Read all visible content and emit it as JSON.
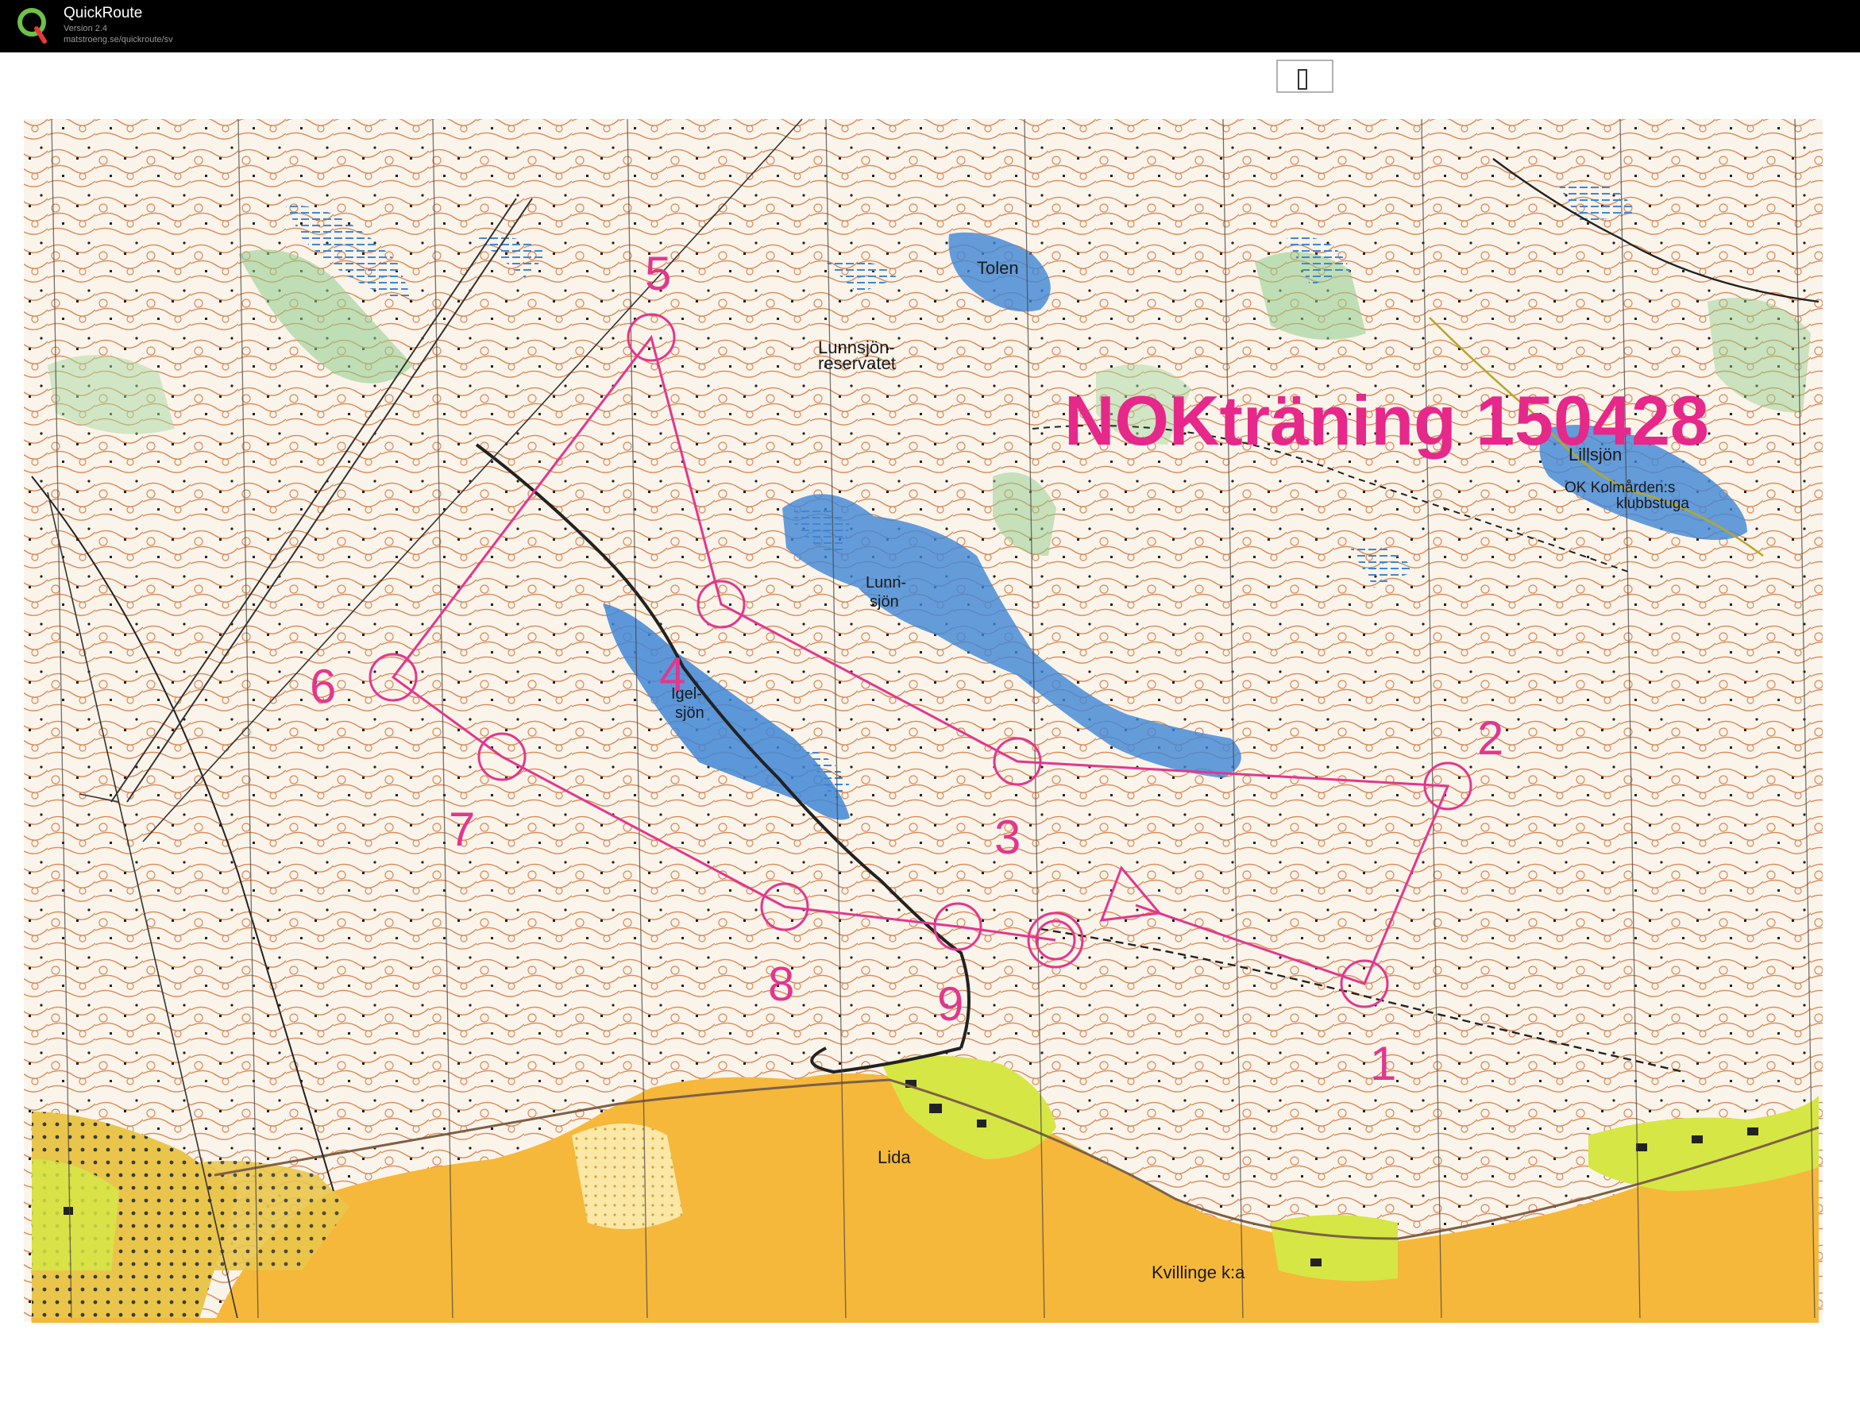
{
  "app": {
    "name": "QuickRoute",
    "version": "Version 2.4",
    "url": "matstroeng.se/quickroute/sv"
  },
  "map": {
    "title": "NOKträning 150428",
    "labels": {
      "tolen": "Tolen",
      "lunnsjon_reservatet_1": "Lunnsjön-",
      "lunnsjon_reservatet_2": "reservatet",
      "lillsjon": "Lillsjön",
      "klubbstuga_1": "OK Kolmården:s",
      "klubbstuga_2": "klubbstuga",
      "lunnsjon_1": "Lunn-",
      "lunnsjon_2": "sjön",
      "igelsjon_1": "Igel-",
      "igelsjon_2": "sjön",
      "lida": "Lida",
      "kvillinge": "Kvillinge k:a"
    },
    "controls": [
      "1",
      "2",
      "3",
      "4",
      "5",
      "6",
      "7",
      "8",
      "9"
    ],
    "colors": {
      "course": "#e2378d",
      "paper": "#fbf6ee",
      "contour": "#d98a5a",
      "water": "#3f86d6",
      "open_land": "#f5b83a",
      "green": "#8fcc8a",
      "settlement": "#d6e645"
    }
  }
}
